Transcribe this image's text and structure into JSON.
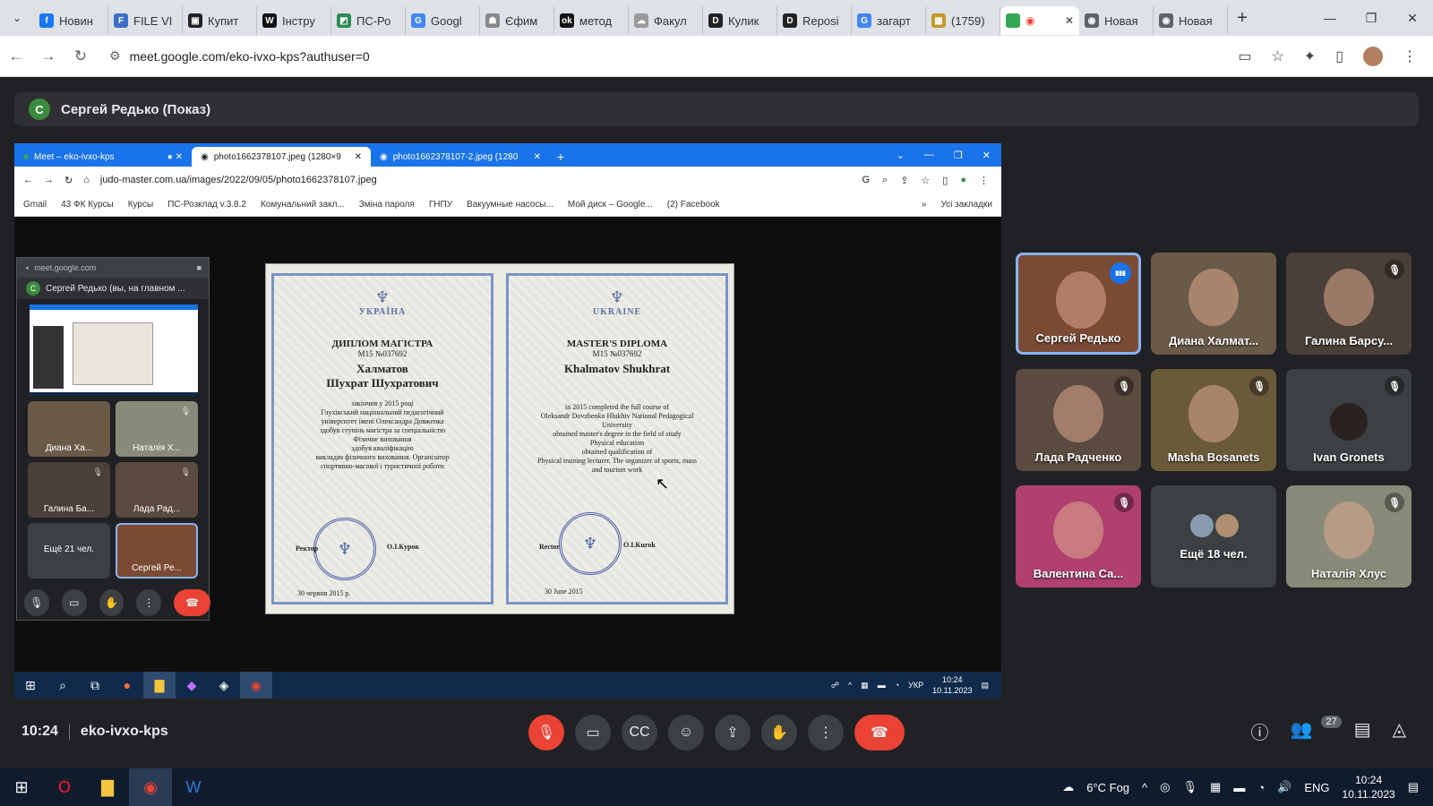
{
  "browser": {
    "tabs": [
      {
        "label": "Новин",
        "color": "#1877f2",
        "glyph": "f"
      },
      {
        "label": "FILE VI",
        "color": "#3b6ec8",
        "glyph": "F"
      },
      {
        "label": "Купит",
        "color": "#222",
        "glyph": "▣"
      },
      {
        "label": "Інстру",
        "color": "#111",
        "glyph": "W"
      },
      {
        "label": "ПС-Ро",
        "color": "#2e8b57",
        "glyph": "◩"
      },
      {
        "label": "Googl",
        "color": "#4285f4",
        "glyph": "G"
      },
      {
        "label": "Єфим",
        "color": "#888",
        "glyph": "☗"
      },
      {
        "label": "метод",
        "color": "#111",
        "glyph": "ok"
      },
      {
        "label": "Факул",
        "color": "#999",
        "glyph": "☁"
      },
      {
        "label": "Кулик",
        "color": "#222",
        "glyph": "D"
      },
      {
        "label": "Reposi",
        "color": "#222",
        "glyph": "D"
      },
      {
        "label": "загарт",
        "color": "#4285f4",
        "glyph": "G"
      },
      {
        "label": "(1759)",
        "color": "#c49a2b",
        "glyph": "▦"
      }
    ],
    "active_tab": {
      "label": "",
      "color": "#34a853"
    },
    "after_tabs": [
      {
        "label": "Новая",
        "color": "#5f6368",
        "glyph": "◉"
      },
      {
        "label": "Новая",
        "color": "#5f6368",
        "glyph": "◉"
      }
    ],
    "url": "meet.google.com/eko-ivxo-kps?authuser=0"
  },
  "meet": {
    "presenter_initial": "C",
    "presenter_label": "Сергей Редько (Показ)",
    "meeting_time": "10:24",
    "meeting_code": "eko-ivxo-kps",
    "participants_count": "27"
  },
  "shared": {
    "tabs": [
      {
        "label": "Meet – eko-ivxo-kps"
      },
      {
        "label": "photo1662378107.jpeg (1280×9"
      },
      {
        "label": "photo1662378107-2.jpeg (1280"
      }
    ],
    "url": "judo-master.com.ua/images/2022/09/05/photo1662378107.jpeg",
    "bookmarks": [
      "Gmail",
      "43 ФК Курсы",
      "Курсы",
      "ПС-Розклад v.3.8.2",
      "Комунальний закл...",
      "Зміна пароля",
      "ГНПУ",
      "Вакуумные насосы...",
      "Мой диск – Google...",
      "(2) Facebook"
    ],
    "bookmarks_more": "»",
    "all_bookmarks": "Усі закладки",
    "pip": {
      "host": "meet.google.com",
      "title": "Сергей Редько (вы, на главном ...",
      "tiles": [
        "Диана Ха...",
        "Наталія Х...",
        "Галина Ба...",
        "Лада Рад...",
        "Ещё 21 чел.",
        "Сергей Ре..."
      ]
    },
    "diploma": {
      "left": {
        "country": "УКРАЇНА",
        "type": "ДИПЛОМ МАГІСТРА",
        "number": "M15 №037692",
        "surname": "Халматов",
        "given": "Шухрат Шухратович",
        "body": [
          "закінчив у 2015 році",
          "Глухівський національний педагогічний",
          "університет імені Олександра Довженка",
          "здобув ступінь магістра за спеціальністю",
          "Фізичне виховання",
          "здобув кваліфікацію",
          "викладач фізичного виховання. Організатор",
          "спортивно-масової і туристичної роботи"
        ],
        "rector": "Ректор",
        "signer": "О.І.Курок",
        "date": "30 червня 2015 р."
      },
      "right": {
        "country": "UKRAINE",
        "type": "MASTER'S DIPLOMA",
        "number": "M15 №037692",
        "name": "Khalmatov Shukhrat",
        "body": [
          "in 2015 completed the full course of",
          "Oleksandr Dovzhenko Hlukhiv National Pedagogical",
          "University",
          "obtained master's degree in the field of study",
          "Physical education",
          "obtained qualification of",
          "Physical training lecturer. The organizer of sports, mass",
          "and tourism work"
        ],
        "rector": "Rector",
        "signer": "O.I.Kurok",
        "date": "30 June 2015"
      }
    },
    "taskbar": {
      "lang": "УКР",
      "time": "10:24",
      "date": "10.11.2023"
    }
  },
  "tiles": [
    {
      "name": "Сергей Редько",
      "state": "speaking",
      "bg": "#7a4a34"
    },
    {
      "name": "Диана Халмат...",
      "state": "",
      "bg": "#6a5a48"
    },
    {
      "name": "Галина Барсу...",
      "state": "muted",
      "bg": "#4a4038"
    },
    {
      "name": "Лада Радченко",
      "state": "muted",
      "bg": "#5a4a40"
    },
    {
      "name": "Masha Bosanets",
      "state": "muted",
      "bg": "#6b5a3a"
    },
    {
      "name": "Ivan Gronets",
      "state": "muted",
      "bg": "#3c4043"
    },
    {
      "name": "Валентина Са...",
      "state": "muted",
      "bg": "#b04070"
    },
    {
      "name": "Ещё 18 чел.",
      "state": "",
      "bg": "#3c4043"
    },
    {
      "name": "Наталія Хлус",
      "state": "muted",
      "bg": "#8a8a7a"
    }
  ],
  "taskbar": {
    "weather": "6°C Fog",
    "lang": "ENG",
    "time": "10:24",
    "date": "10.11.2023"
  }
}
